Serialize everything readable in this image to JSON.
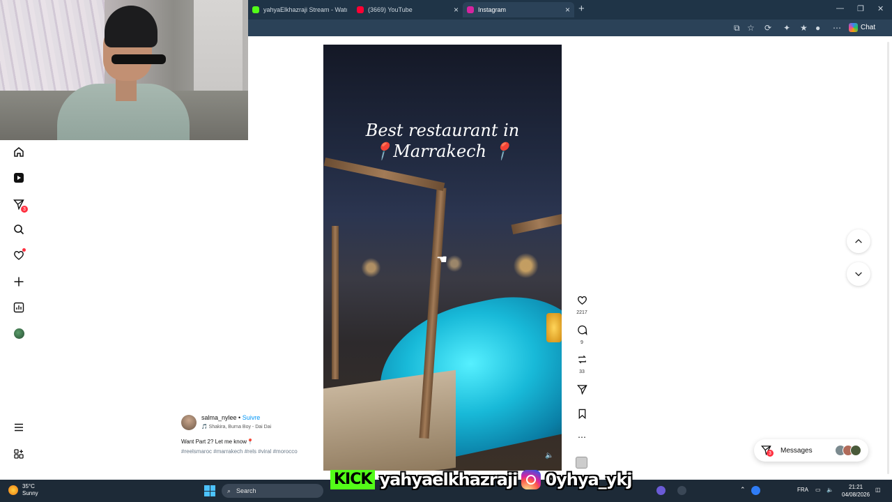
{
  "browser": {
    "tabs": [
      {
        "title": "yahyaElkhazraji Stream - Watch Li",
        "fav_color": "#53fc18"
      },
      {
        "title": "(3669) YouTube",
        "fav_color": "#ff0033"
      },
      {
        "title": "Instagram",
        "fav_color": "#d6249f"
      }
    ],
    "chat_label": "Chat"
  },
  "reel": {
    "title_line1": "Best restaurant in",
    "title_line2": "📍Marrakech 📍",
    "likes": "2217",
    "comments": "9",
    "reposts": "33"
  },
  "caption": {
    "username": "salma_nylee",
    "separator": " • ",
    "follow_label": "Suivre",
    "song": "🎵 Shakira, Burna Boy - Dai Dai",
    "text": "Want Part 2? Let me know📍",
    "hashtags": "#reelsmaroc #marrakech #rels #viral #morocco"
  },
  "sidebar": {
    "messages_badge": "3"
  },
  "messages_widget": {
    "label": "Messages",
    "badge": "3"
  },
  "overlay": {
    "kick_label": "KICK",
    "kick_handle": "yahyaelkhazraji",
    "ig_handle": "0yhya_ykj"
  },
  "taskbar": {
    "temperature": "35°C",
    "condition": "Sunny",
    "search_placeholder": "Search",
    "language": "FRA",
    "time": "21:21",
    "date": "04/08/2026"
  }
}
